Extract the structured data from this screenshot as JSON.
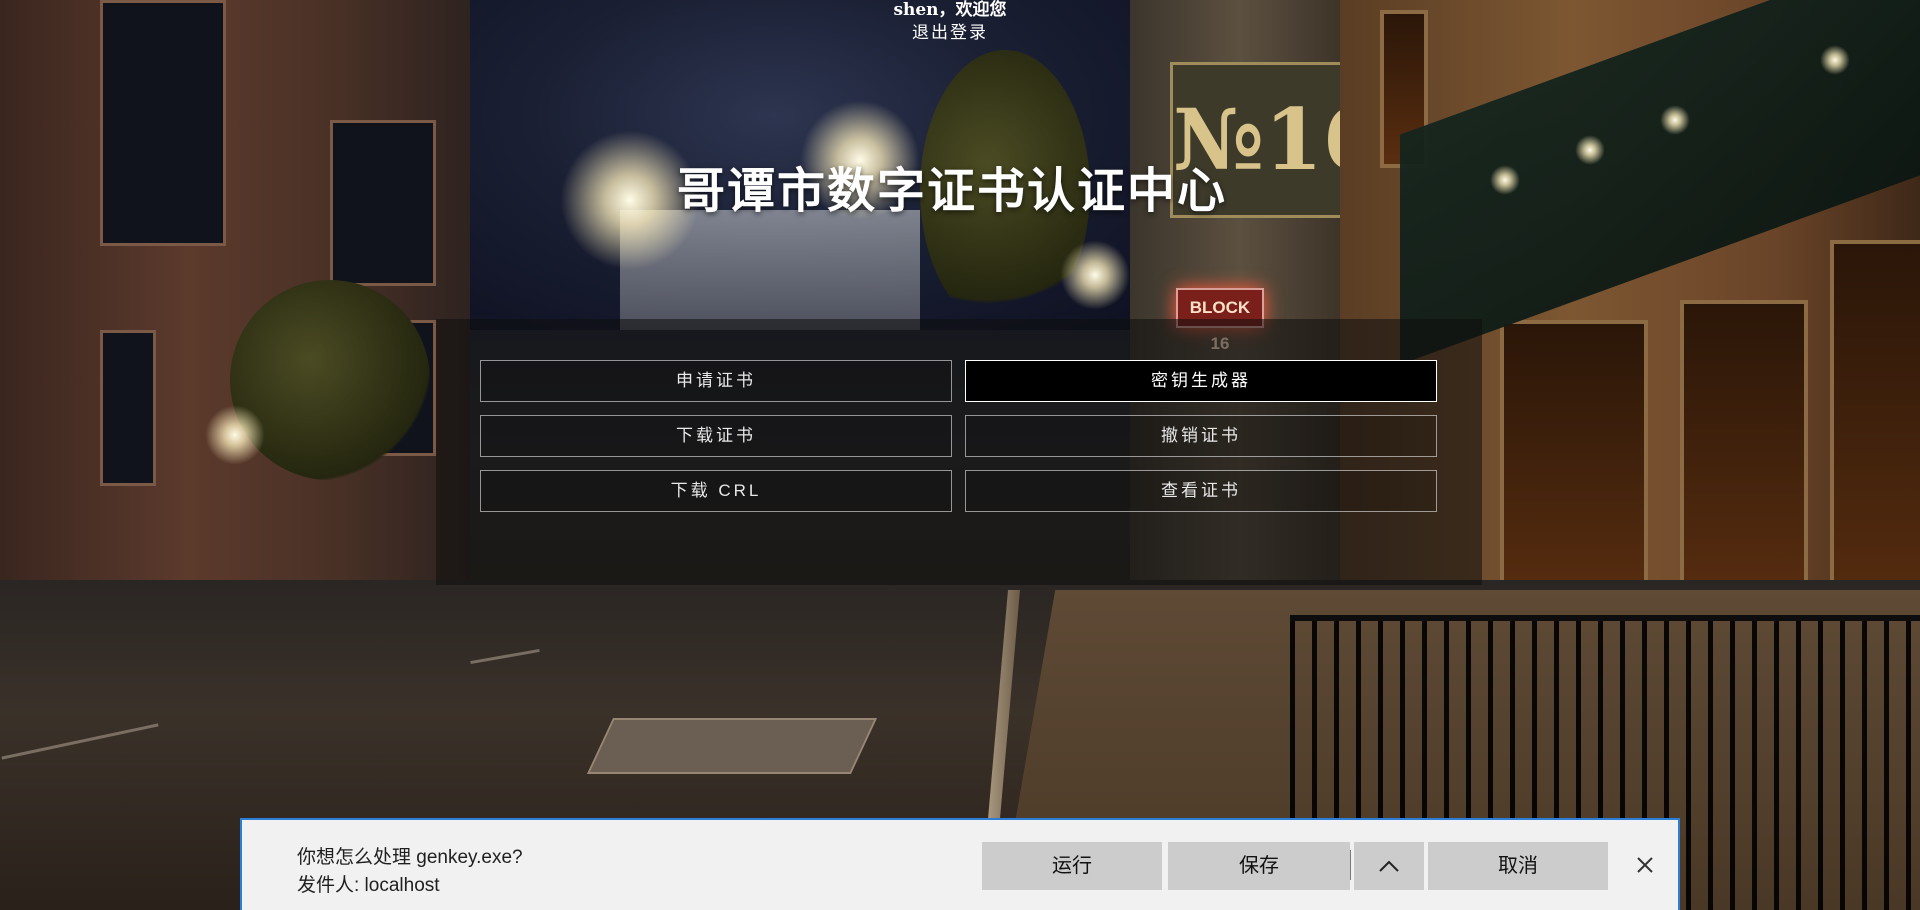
{
  "header": {
    "greeting": "shen，欢迎您",
    "logout_label": "退出登录"
  },
  "page": {
    "title": "哥谭市数字证书认证中心"
  },
  "menu": {
    "apply_cert": "申请证书",
    "key_generator": "密钥生成器",
    "download_cert": "下载证书",
    "revoke_cert": "撤销证书",
    "download_crl": "下载 CRL",
    "view_cert": "查看证书",
    "active_item": "key_generator"
  },
  "background": {
    "sign_text": "№16",
    "neon_sign": "BLOCK 16"
  },
  "download_bar": {
    "question": "你想怎么处理 genkey.exe?",
    "publisher": "发件人: localhost",
    "run_label": "运行",
    "save_label": "保存",
    "save_options_icon": "chevron-up-icon",
    "cancel_label": "取消",
    "close_icon": "close-icon"
  },
  "colors": {
    "download_bar_border": "#2b7fd6",
    "active_button_bg": "#000000"
  }
}
